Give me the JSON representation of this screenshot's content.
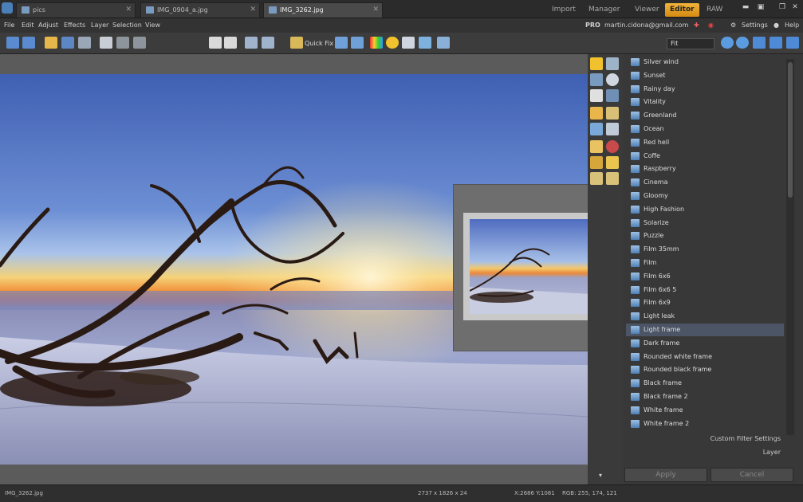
{
  "tabs": {
    "docs": [
      {
        "label": "pics",
        "active": false
      },
      {
        "label": "IMG_0904_a.jpg",
        "active": false
      },
      {
        "label": "IMG_3262.jpg",
        "active": true
      }
    ],
    "modes": [
      "Import",
      "Manager",
      "Viewer",
      "Editor",
      "RAW"
    ],
    "active_mode": "Editor"
  },
  "menu": {
    "items": [
      "File",
      "Edit",
      "Adjust",
      "Effects",
      "Layer",
      "Selection",
      "View"
    ],
    "pro_badge": "PRO",
    "account_email": "martin.cidona@gmail.com",
    "settings_label": "Settings",
    "help_label": "Help"
  },
  "toolbar": {
    "quick_fix_label": "Quick Fix",
    "zoom_value": "Fit"
  },
  "filters": {
    "items": [
      "Silver wind",
      "Sunset",
      "Rainy day",
      "Vitality",
      "Greenland",
      "Ocean",
      "Red hell",
      "Coffe",
      "Raspberry",
      "Cinema",
      "Gloomy",
      "High Fashion",
      "Solarize",
      "Puzzle",
      "Film 35mm",
      "Film",
      "Film 6x6",
      "Film 6x6 5",
      "Film 6x9",
      "Light leak",
      "Light frame",
      "Dark frame",
      "Rounded white frame",
      "Rounded black frame",
      "Black frame",
      "Black frame 2",
      "White frame",
      "White frame 2"
    ],
    "selected": "Light frame",
    "custom_settings_label": "Custom Filter Settings",
    "layer_label": "Layer",
    "apply_label": "Apply",
    "cancel_label": "Cancel"
  },
  "status": {
    "filename": "IMG_3262.jpg",
    "dimensions": "2737 x 1826 x 24",
    "coordinates": "X:2686 Y:1081",
    "rgb": "RGB: 255, 174, 121"
  },
  "colors": {
    "active_mode_bg": "#e8a126",
    "sky_top": "#3e5db0",
    "sunset_orange": "#f08a32",
    "selected_row": "#4b5566"
  }
}
